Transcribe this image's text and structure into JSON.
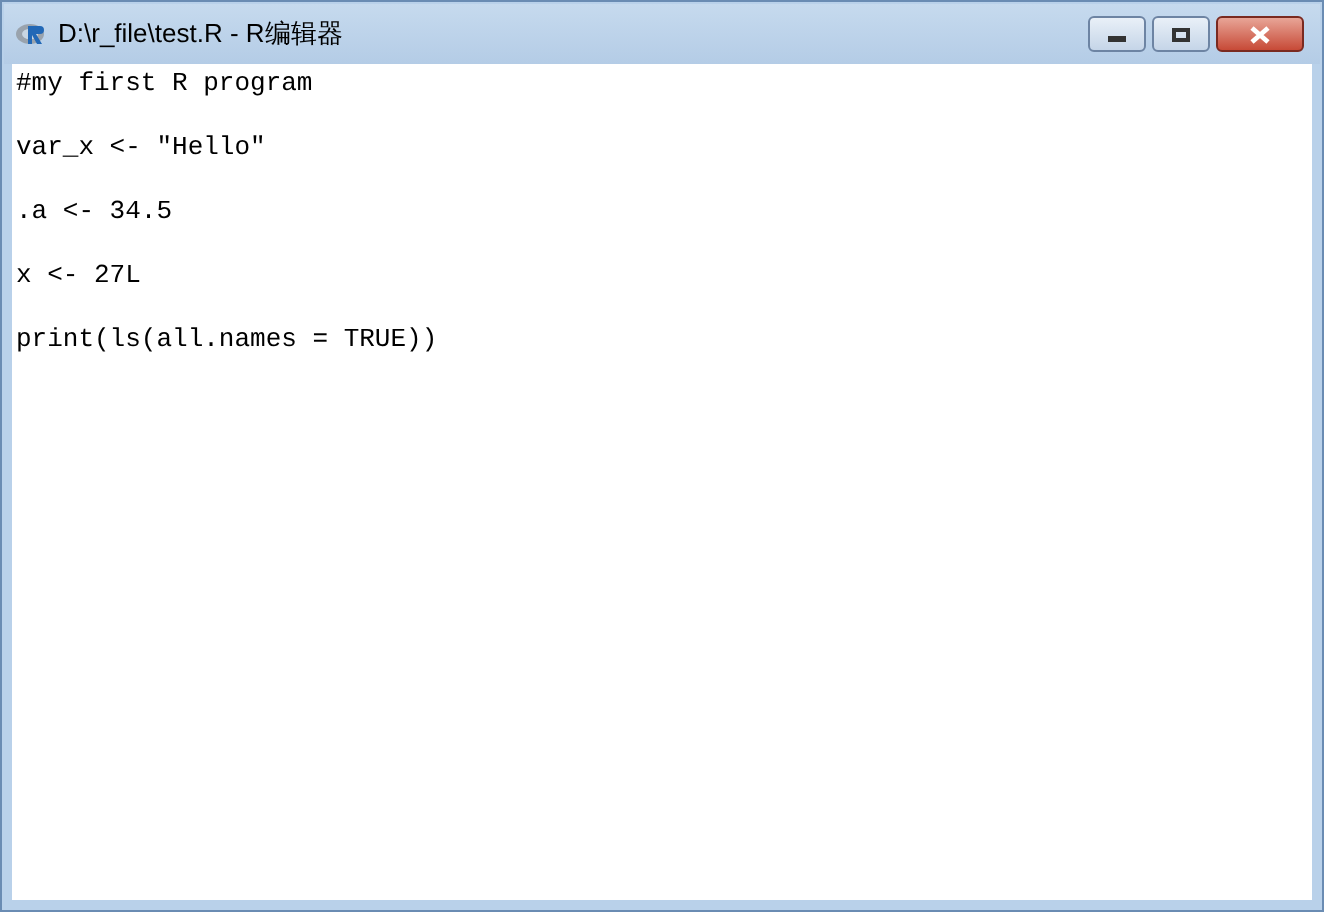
{
  "window": {
    "title": "D:\\r_file\\test.R - R编辑器"
  },
  "editor": {
    "lines": [
      "#my first R program",
      "var_x <- \"Hello\"",
      ".a <- 34.5",
      "x <- 27L",
      "print(ls(all.names = TRUE))"
    ]
  }
}
